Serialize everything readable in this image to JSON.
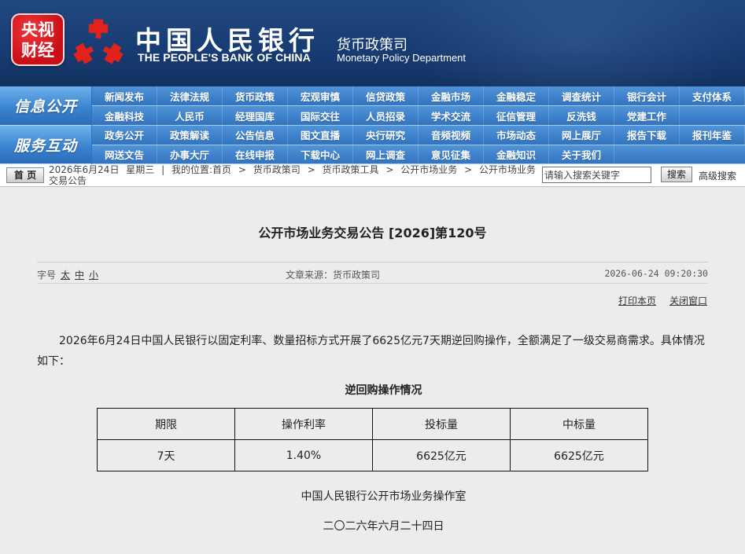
{
  "header": {
    "cctv_logo_line1": "央视",
    "cctv_logo_line2": "财经",
    "bank_name_cn": "中国人民银行",
    "bank_name_en": "THE PEOPLE'S BANK OF CHINA",
    "dept_cn": "货币政策司",
    "dept_en": "Monetary Policy Department"
  },
  "nav": {
    "groups": [
      {
        "label": "信息公开",
        "rows": [
          [
            "新闻发布",
            "法律法规",
            "货币政策",
            "宏观审慎",
            "信贷政策",
            "金融市场",
            "金融稳定",
            "调查统计",
            "银行会计",
            "支付体系"
          ],
          [
            "金融科技",
            "人民币",
            "经理国库",
            "国际交往",
            "人员招录",
            "学术交流",
            "征信管理",
            "反洗钱",
            "党建工作"
          ]
        ]
      },
      {
        "label": "服务互动",
        "rows": [
          [
            "政务公开",
            "政策解读",
            "公告信息",
            "图文直播",
            "央行研究",
            "音频视频",
            "市场动态",
            "网上展厅",
            "报告下载",
            "报刊年鉴"
          ],
          [
            "网送文告",
            "办事大厅",
            "在线申报",
            "下载中心",
            "网上调查",
            "意见征集",
            "金融知识",
            "关于我们"
          ]
        ]
      }
    ]
  },
  "breadcrumb": {
    "home_label": "首 页",
    "date": "2026年6月24日",
    "weekday": "星期三",
    "divider": "|",
    "location_prefix": "我的位置:",
    "separator": ">",
    "path": [
      "首页",
      "货币政策司",
      "货币政策工具",
      "公开市场业务",
      "公开市场业务交易公告"
    ]
  },
  "search": {
    "placeholder": "请输入搜索关键字",
    "button_label": "搜索",
    "advanced_label": "高级搜索"
  },
  "article": {
    "title": "公开市场业务交易公告 [2026]第120号",
    "font_size_label": "字号",
    "font_sizes": [
      "太",
      "中",
      "小"
    ],
    "source": "文章来源：货币政策司",
    "datetime": "2026-06-24 09:20:30",
    "print_label": "打印本页",
    "close_label": "关闭窗口",
    "body": "2026年6月24日中国人民银行以固定利率、数量招标方式开展了6625亿元7天期逆回购操作，全额满足了一级交易商需求。具体情况如下：",
    "table_title": "逆回购操作情况",
    "table": {
      "headers": [
        "期限",
        "操作利率",
        "投标量",
        "中标量"
      ],
      "rows": [
        [
          "7天",
          "1.40%",
          "6625亿元",
          "6625亿元"
        ]
      ]
    },
    "signature": "中国人民银行公开市场业务操作室",
    "date_cn": "二〇二六年六月二十四日"
  },
  "theme": {
    "header_bg": "#183d74",
    "nav_bg": "#3274c0",
    "logo_red": "#d8141b",
    "emblem_red": "#e2221b",
    "content_bg": "#ececec"
  }
}
